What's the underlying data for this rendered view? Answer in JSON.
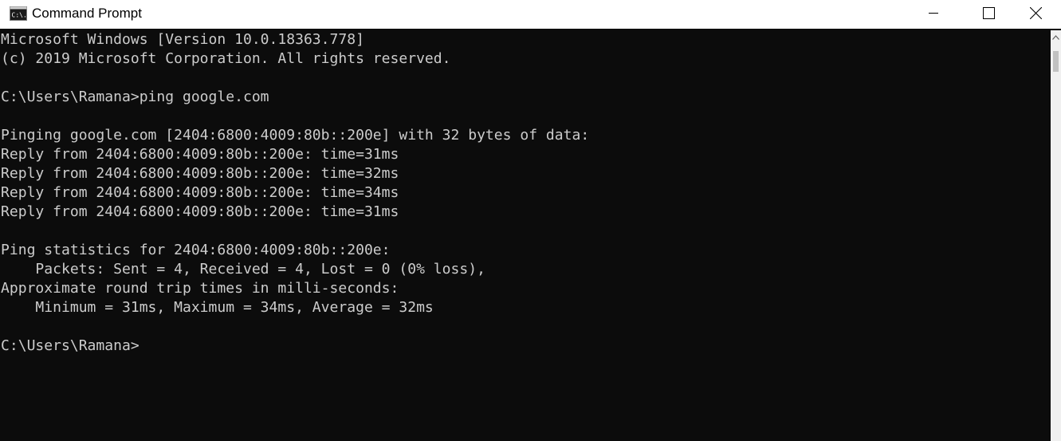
{
  "window": {
    "title": "Command Prompt",
    "icon_name": "cmd-icon",
    "icon_text": "C:\\."
  },
  "controls": {
    "minimize_icon": "minimize-icon",
    "maximize_icon": "maximize-icon",
    "close_icon": "close-icon"
  },
  "console": {
    "background": "#0c0c0c",
    "foreground": "#cccccc",
    "lines": [
      "Microsoft Windows [Version 10.0.18363.778]",
      "(c) 2019 Microsoft Corporation. All rights reserved.",
      "",
      "C:\\Users\\Ramana>ping google.com",
      "",
      "Pinging google.com [2404:6800:4009:80b::200e] with 32 bytes of data:",
      "Reply from 2404:6800:4009:80b::200e: time=31ms",
      "Reply from 2404:6800:4009:80b::200e: time=32ms",
      "Reply from 2404:6800:4009:80b::200e: time=34ms",
      "Reply from 2404:6800:4009:80b::200e: time=31ms",
      "",
      "Ping statistics for 2404:6800:4009:80b::200e:",
      "    Packets: Sent = 4, Received = 4, Lost = 0 (0% loss),",
      "Approximate round trip times in milli-seconds:",
      "    Minimum = 31ms, Maximum = 34ms, Average = 32ms",
      "",
      "C:\\Users\\Ramana>"
    ]
  },
  "scrollbar": {
    "up_icon": "scroll-up-arrow-icon"
  }
}
